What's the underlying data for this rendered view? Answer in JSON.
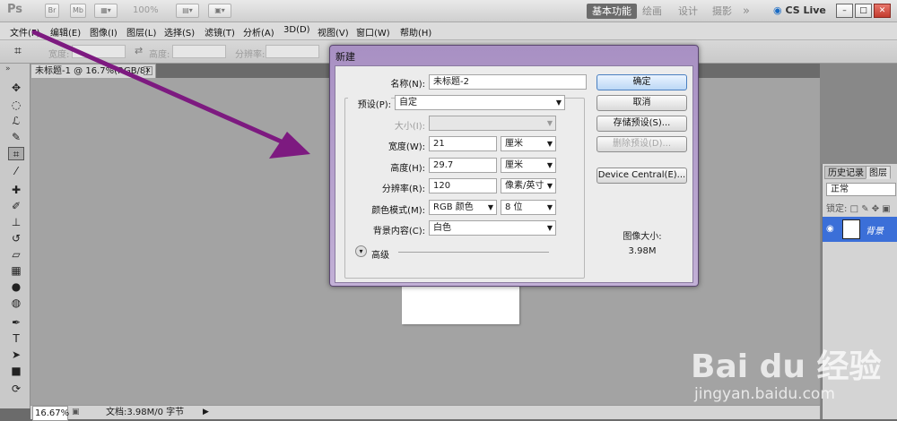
{
  "app": {
    "logo": "Ps",
    "zoom": "100%",
    "workspaces": [
      "基本功能",
      "绘画",
      "设计",
      "摄影"
    ],
    "more": "»",
    "cs_live": "CS Live",
    "win_minimize": "–",
    "win_restore": "□",
    "win_close": "✕"
  },
  "menubar": [
    "文件(F)",
    "编辑(E)",
    "图像(I)",
    "图层(L)",
    "选择(S)",
    "滤镜(T)",
    "分析(A)",
    "3D(D)",
    "视图(V)",
    "窗口(W)",
    "帮助(H)"
  ],
  "options": {
    "width_label": "宽度:",
    "height_label": "高度:",
    "resolution_label": "分辨率:",
    "swap": "⇄"
  },
  "doc_tab": {
    "title": "未标题-1 @ 16.7%(RGB/8)",
    "close": "✕"
  },
  "status": {
    "zoom": "16.67%",
    "doc": "文档:3.98M/0 字节",
    "arrow": "▶"
  },
  "panel": {
    "tabs": [
      "历史记录",
      "图层"
    ],
    "blend_mode": "正常",
    "lock_label": "锁定:",
    "layer_name": "背景"
  },
  "dialog": {
    "title": "新建",
    "name_label": "名称(N):",
    "name_value": "未标题-2",
    "preset_label": "预设(P):",
    "preset_value": "自定",
    "size_label": "大小(I):",
    "size_value": "",
    "width_label": "宽度(W):",
    "width_value": "21",
    "width_unit": "厘米",
    "height_label": "高度(H):",
    "height_value": "29.7",
    "height_unit": "厘米",
    "resolution_label": "分辨率(R):",
    "resolution_value": "120",
    "resolution_unit": "像素/英寸",
    "color_mode_label": "颜色模式(M):",
    "color_mode_value": "RGB 颜色",
    "bit_depth": "8 位",
    "background_label": "背景内容(C):",
    "background_value": "白色",
    "advanced_label": "高级",
    "ok_button": "确定",
    "cancel_button": "取消",
    "save_preset_button": "存储预设(S)...",
    "delete_preset_button": "删除预设(D)...",
    "device_central_button": "Device Central(E)...",
    "image_size_label": "图像大小:",
    "image_size_value": "3.98M"
  },
  "watermark": {
    "brand": "Bai du 经验",
    "url": "jingyan.baidu.com"
  },
  "colors": {
    "dialog_frame": "#b7a3cf",
    "annotation_arrow": "#7d1a80",
    "selected_layer": "#3b6fd8"
  }
}
